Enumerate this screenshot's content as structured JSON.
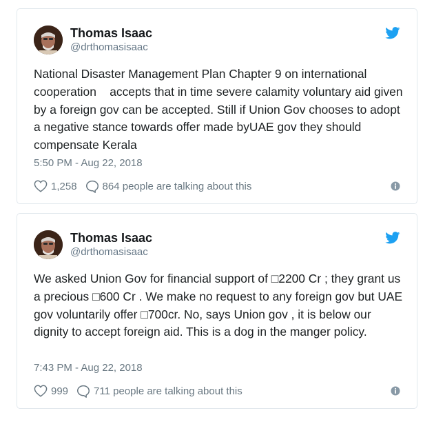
{
  "tweets": [
    {
      "author_name": "Thomas Isaac",
      "handle": "@drthomasisaac",
      "text": "National Disaster Management Plan Chapter 9 on international cooperation    accepts that in time severe calamity voluntary aid given by a foreign gov can be accepted. Still if Union Gov chooses to adopt a negative stance towards offer made byUAE gov they should compensate Kerala",
      "timestamp": "5:50 PM - Aug 22, 2018",
      "likes": "1,258",
      "talking": "864 people are talking about this"
    },
    {
      "author_name": "Thomas Isaac",
      "handle": "@drthomasisaac",
      "text": "We asked Union Gov for financial support of □2200 Cr ; they grant us a precious □600 Cr . We make no request to any foreign gov but UAE gov voluntarily offer □700cr. No, says Union gov , it is below our dignity to accept foreign aid. This is a dog in the manger policy.",
      "timestamp": "7:43 PM - Aug 22, 2018",
      "likes": "999",
      "talking": "711 people are talking about this"
    }
  ],
  "icons": {
    "brand": "twitter-bird-icon",
    "like": "heart-icon",
    "reply": "speech-bubble-icon",
    "info": "info-icon"
  },
  "colors": {
    "twitter_blue": "#1da1f2",
    "text": "#1c2022",
    "muted": "#697882",
    "border": "#e1e8ed"
  }
}
